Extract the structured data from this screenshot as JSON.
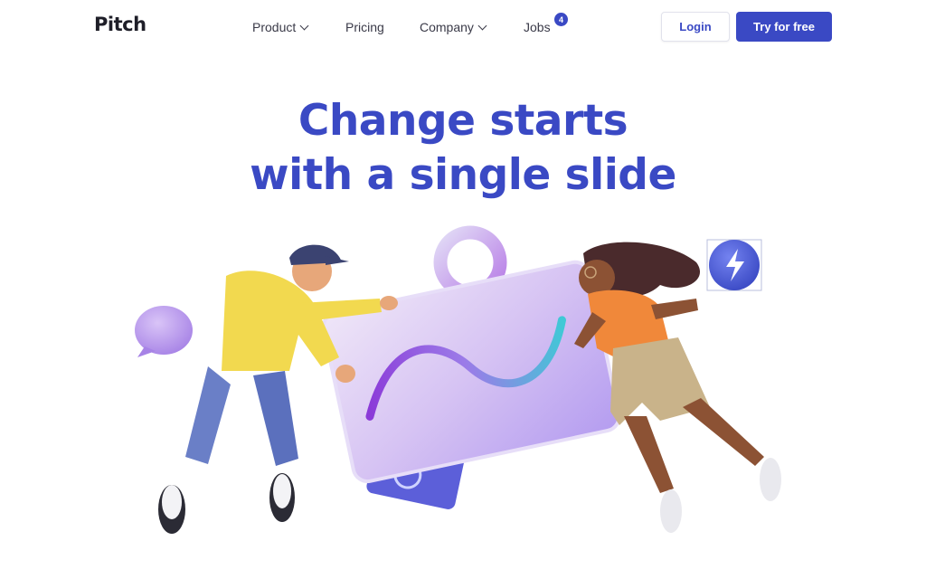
{
  "brand": {
    "logo_text": "Pitch"
  },
  "nav": {
    "items": [
      {
        "label": "Product",
        "has_dropdown": true
      },
      {
        "label": "Pricing",
        "has_dropdown": false
      },
      {
        "label": "Company",
        "has_dropdown": true
      },
      {
        "label": "Jobs",
        "has_dropdown": false,
        "badge": "4"
      }
    ]
  },
  "actions": {
    "login_label": "Login",
    "try_label": "Try for free"
  },
  "hero": {
    "title_line1": "Change starts",
    "title_line2": "with a single slide"
  },
  "colors": {
    "accent": "#3a49c4",
    "text": "#3a3a48",
    "background": "#ffffff"
  },
  "icons": [
    "chevron-down-icon",
    "lightning-icon",
    "speech-bubble-icon",
    "check-icon"
  ]
}
